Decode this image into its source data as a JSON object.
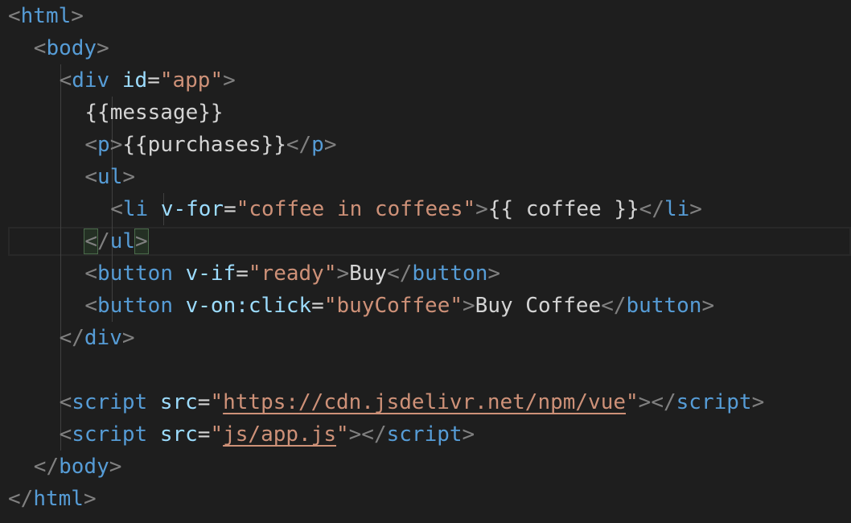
{
  "editor": {
    "lines": [
      {
        "parts": [
          [
            "b",
            "<"
          ],
          [
            "t",
            "html"
          ],
          [
            "b",
            ">"
          ]
        ]
      },
      {
        "parts": [
          [
            "b",
            "<"
          ],
          [
            "t",
            "body"
          ],
          [
            "b",
            ">"
          ]
        ]
      },
      {
        "parts": [
          [
            "b",
            "<"
          ],
          [
            "t",
            "div"
          ],
          [
            "x",
            " "
          ],
          [
            "a",
            "id"
          ],
          [
            "e",
            "="
          ],
          [
            "v",
            "\"app\""
          ],
          [
            "b",
            ">"
          ]
        ]
      },
      {
        "parts": [
          [
            "x",
            "{{message}}"
          ]
        ]
      },
      {
        "parts": [
          [
            "b",
            "<"
          ],
          [
            "t",
            "p"
          ],
          [
            "b",
            ">"
          ],
          [
            "x",
            "{{purchases}}"
          ],
          [
            "b",
            "</"
          ],
          [
            "t",
            "p"
          ],
          [
            "b",
            ">"
          ]
        ]
      },
      {
        "parts": [
          [
            "b",
            "<"
          ],
          [
            "t",
            "ul"
          ],
          [
            "b",
            ">"
          ]
        ]
      },
      {
        "parts": [
          [
            "b",
            "<"
          ],
          [
            "t",
            "li"
          ],
          [
            "x",
            " "
          ],
          [
            "a",
            "v-for"
          ],
          [
            "e",
            "="
          ],
          [
            "v",
            "\"coffee in coffees\""
          ],
          [
            "b",
            ">"
          ],
          [
            "x",
            "{{ coffee }}"
          ],
          [
            "b",
            "</"
          ],
          [
            "t",
            "li"
          ],
          [
            "b",
            ">"
          ]
        ]
      },
      {
        "parts": [
          [
            "m",
            "<"
          ],
          [
            "b",
            "/"
          ],
          [
            "t",
            "ul"
          ],
          [
            "m",
            ">"
          ]
        ]
      },
      {
        "parts": [
          [
            "b",
            "<"
          ],
          [
            "t",
            "button"
          ],
          [
            "x",
            " "
          ],
          [
            "a",
            "v-if"
          ],
          [
            "e",
            "="
          ],
          [
            "v",
            "\"ready\""
          ],
          [
            "b",
            ">"
          ],
          [
            "x",
            "Buy"
          ],
          [
            "b",
            "</"
          ],
          [
            "t",
            "button"
          ],
          [
            "b",
            ">"
          ]
        ]
      },
      {
        "parts": [
          [
            "b",
            "<"
          ],
          [
            "t",
            "button"
          ],
          [
            "x",
            " "
          ],
          [
            "a",
            "v-on:click"
          ],
          [
            "e",
            "="
          ],
          [
            "v",
            "\"buyCoffee\""
          ],
          [
            "b",
            ">"
          ],
          [
            "x",
            "Buy Coffee"
          ],
          [
            "b",
            "</"
          ],
          [
            "t",
            "button"
          ],
          [
            "b",
            ">"
          ]
        ]
      },
      {
        "parts": [
          [
            "b",
            "</"
          ],
          [
            "t",
            "div"
          ],
          [
            "b",
            ">"
          ]
        ]
      },
      {
        "parts": []
      },
      {
        "parts": [
          [
            "b",
            "<"
          ],
          [
            "t",
            "script"
          ],
          [
            "x",
            " "
          ],
          [
            "a",
            "src"
          ],
          [
            "e",
            "="
          ],
          [
            "v",
            "\""
          ],
          [
            "l",
            "https://cdn.jsdelivr.net/npm/vue"
          ],
          [
            "v",
            "\""
          ],
          [
            "b",
            "></"
          ],
          [
            "t",
            "script"
          ],
          [
            "b",
            ">"
          ]
        ]
      },
      {
        "parts": [
          [
            "b",
            "<"
          ],
          [
            "t",
            "script"
          ],
          [
            "x",
            " "
          ],
          [
            "a",
            "src"
          ],
          [
            "e",
            "="
          ],
          [
            "v",
            "\""
          ],
          [
            "l",
            "js/app.js"
          ],
          [
            "v",
            "\""
          ],
          [
            "b",
            "></"
          ],
          [
            "t",
            "script"
          ],
          [
            "b",
            ">"
          ]
        ]
      },
      {
        "parts": [
          [
            "b",
            "</"
          ],
          [
            "t",
            "body"
          ],
          [
            "b",
            ">"
          ]
        ]
      },
      {
        "parts": [
          [
            "b",
            "</"
          ],
          [
            "t",
            "html"
          ],
          [
            "b",
            ">"
          ]
        ]
      }
    ]
  },
  "colors": {
    "background": "#1e1e1e",
    "tag_bracket": "#808080",
    "tag_name": "#569cd6",
    "attr_name": "#9cdcfe",
    "attr_value": "#ce9178",
    "text": "#d4d4d4"
  }
}
